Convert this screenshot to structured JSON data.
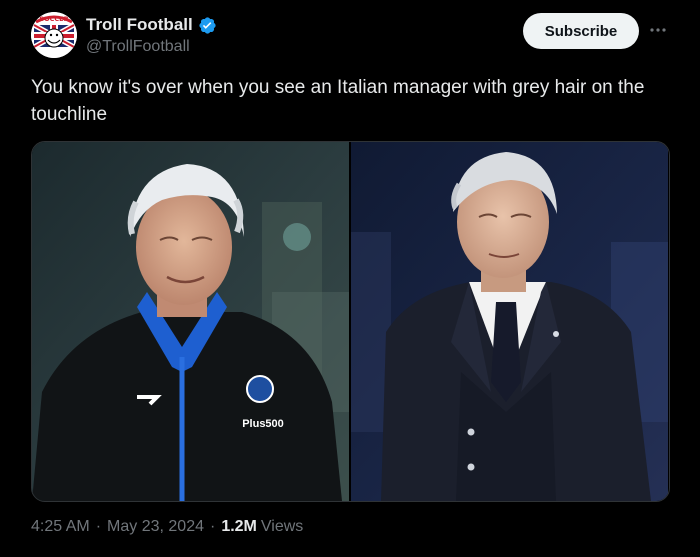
{
  "post": {
    "author": {
      "display_name": "Troll Football",
      "handle": "@TrollFootball",
      "verified": true,
      "avatar_badge_text": "SOCCER",
      "icon": "verified-badge-icon"
    },
    "subscribe_label": "Subscribe",
    "text": "You know it's over when you see an Italian manager with grey hair on the touchline",
    "media": {
      "left_photo": {
        "shirt_text": "Plus500"
      },
      "right_photo": {}
    },
    "meta": {
      "time": "4:25 AM",
      "separator": "·",
      "date": "May 23, 2024",
      "views_count": "1.2M",
      "views_label": "Views"
    }
  },
  "colors": {
    "background": "#000000",
    "text_primary": "#e7e9ea",
    "text_secondary": "#71767b",
    "verified_blue": "#1d9bf0",
    "subscribe_bg": "#eff3f4"
  }
}
